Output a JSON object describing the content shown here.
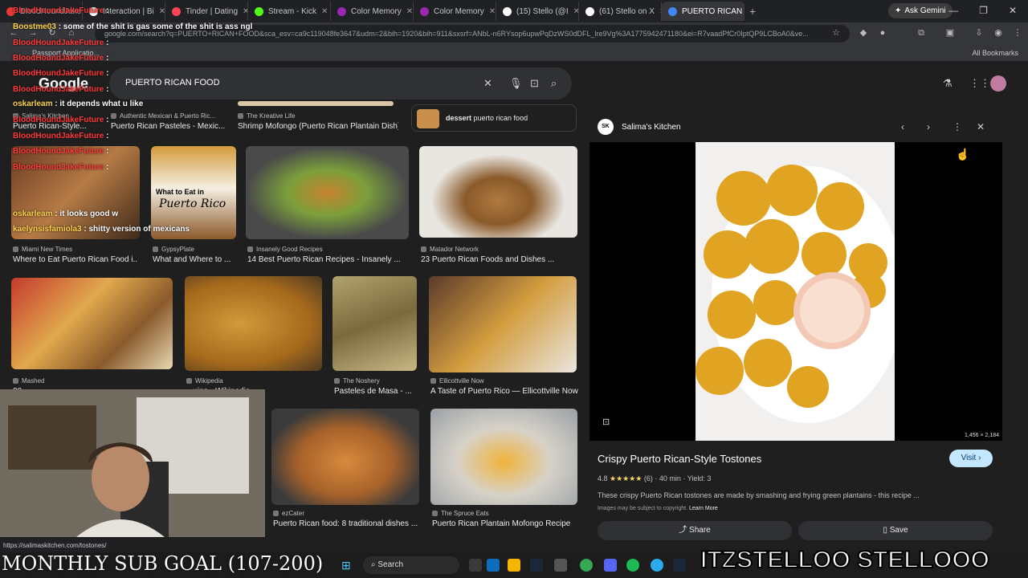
{
  "browser": {
    "tabs": [
      {
        "label": "BloodHoundJakeFuture",
        "color": "#e53935"
      },
      {
        "label": "Interaction | Bi",
        "color": "#ffffff"
      },
      {
        "label": "Tinder | Dating",
        "color": "#ff4458"
      },
      {
        "label": "Stream - Kick",
        "color": "#53fc18"
      },
      {
        "label": "Color Memory",
        "color": "#9c27b0"
      },
      {
        "label": "Color Memory",
        "color": "#9c27b0"
      },
      {
        "label": "(15) Stello (@I",
        "color": "#ffffff"
      },
      {
        "label": "(61) Stello on X",
        "color": "#ffffff"
      },
      {
        "label": "PUERTO RICAN",
        "color": "#4285f4"
      }
    ],
    "new_tab": "+",
    "ask_gemini": "Ask Gemini",
    "url": "google.com/search?q=PUERTO+RICAN+FOOD&sca_esv=ca9c119048fe3647&udm=2&bih=1920&bih=911&sxsrf=ANbL-n6RYsop6upwPqDzWS0dDFL_lre9Vg%3A1775942471180&ei=R7vaadPfCr0IptQP9LCBoA0&ve...",
    "bookmark_passport": "Passport Applicatio...",
    "all_bookmarks": "All Bookmarks"
  },
  "google": {
    "logo": "Google",
    "query": "PUERTO RICAN FOOD"
  },
  "results": {
    "row0": [
      {
        "source": "Salima's Kitchen",
        "title": "Puerto Rican-Style..."
      },
      {
        "source": "Authentic Mexican & Puerto Ric...",
        "title": "Puerto Rican Pasteles - Mexic..."
      },
      {
        "source": "The Kreative Life",
        "title": "Shrimp Mofongo (Puerto Rican Plantain Dish)"
      }
    ],
    "dessert_chip": {
      "bold": "dessert",
      "rest": " puerto rican food"
    },
    "row1": [
      {
        "source": "Miami New Times",
        "title": "Where to Eat Puerto Rican Food i..."
      },
      {
        "source": "GypsyPlate",
        "title": "What and Where to ...",
        "overlay1": "What to Eat in",
        "overlay2": "Puerto Rico"
      },
      {
        "source": "Insanely Good Recipes",
        "title": "14 Best Puerto Rican Recipes - Insanely ..."
      },
      {
        "source": "Matador Network",
        "title": "23 Puerto Rican Foods and Dishes ..."
      }
    ],
    "row2": [
      {
        "source": "Mashed",
        "title": "20 ..."
      },
      {
        "source": "Wikipedia",
        "title": "...uine - Wikipedia"
      },
      {
        "source": "The Noshery",
        "title": "Pasteles de Masa - ..."
      },
      {
        "source": "Ellicottville Now",
        "title": "A Taste of Puerto Rico — Ellicottville Now"
      }
    ],
    "row3": [
      {
        "source": "ezCater",
        "title": "Puerto Rican food: 8 traditional dishes ..."
      },
      {
        "source": "The Spruce Eats",
        "title": "Puerto Rican Plantain Mofongo Recipe"
      }
    ]
  },
  "panel": {
    "avatar": "SK",
    "site": "Salima's Kitchen",
    "dims": "1,456 × 2,184",
    "title": "Crispy Puerto Rican-Style Tostones",
    "visit": "Visit",
    "rating": "4.8",
    "stars": "★★★★★",
    "reviews": "(6)",
    "time": "40 min",
    "yield": "Yield: 3",
    "description": "These crispy Puerto Rican tostones are made by smashing and frying green plantains - this recipe ...",
    "copyright": "Images may be subject to copyright.",
    "learn_more": "Learn More",
    "share": "Share",
    "save": "Save"
  },
  "chat": [
    {
      "name": "BloodHoundJakeFuture",
      "text": ":"
    },
    {
      "name": "Boostme03",
      "text": ": some of the shit is gas some of the shit is ass ngl"
    },
    {
      "name": "BloodHoundJakeFuture",
      "text": ":"
    },
    {
      "name": "BloodHoundJakeFuture",
      "text": ":"
    },
    {
      "name": "BloodHoundJakeFuture",
      "text": ":"
    },
    {
      "name": "BloodHoundJakeFuture",
      "text": ":"
    },
    {
      "name": "oskarleam",
      "text": ": it depends what u like"
    },
    {
      "name": "BloodHoundJakeFuture",
      "text": ":"
    },
    {
      "name": "BloodHoundJakeFuture",
      "text": ":"
    },
    {
      "name": "BloodHoundJakeFuture",
      "text": ":"
    },
    {
      "name": "BloodHoundJakeFuture",
      "text": ":"
    },
    {
      "name": "oskarleam",
      "text": ": it looks good w"
    },
    {
      "name": "kaelynsisfamiola3",
      "text": ": shitty version of mexicans"
    }
  ],
  "status_url": "https://salimaskitchen.com/tostones/",
  "overlay": {
    "goal": "MONTHLY SUB GOAL (107-200)",
    "social": "ITZSTELLOO  STELLOOO"
  },
  "taskbar": {
    "search": "Search"
  },
  "colors": {
    "link_blue": "#c2e7ff",
    "star": "#fdd663",
    "chat_name": "#ff3a3a"
  }
}
